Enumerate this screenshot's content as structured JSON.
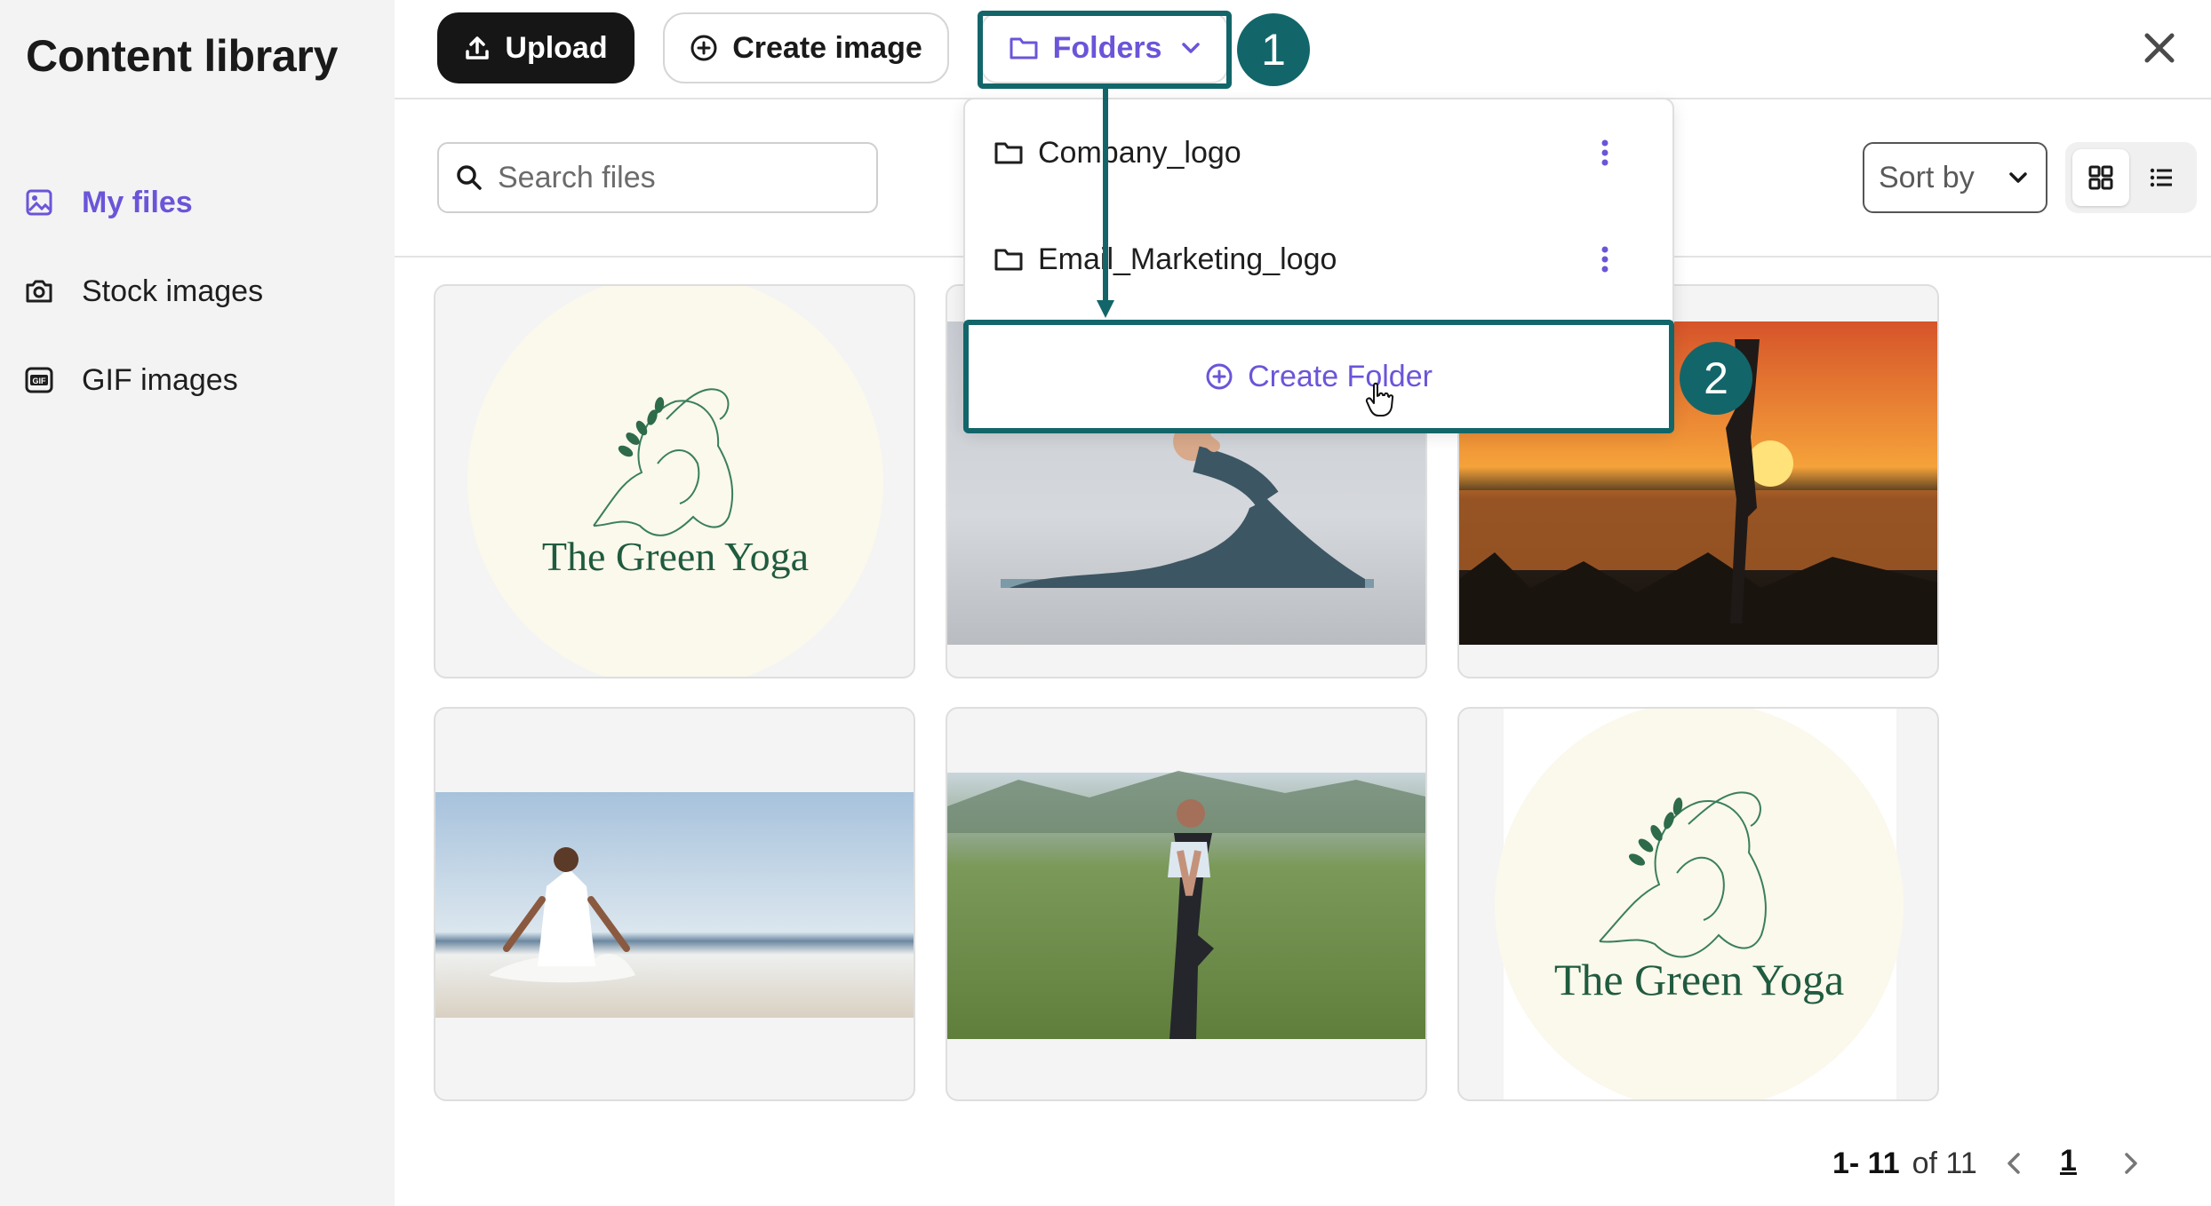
{
  "sidebar": {
    "title": "Content library",
    "items": [
      {
        "label": "My files",
        "icon": "image-icon",
        "active": true
      },
      {
        "label": "Stock images",
        "icon": "camera-icon",
        "active": false
      },
      {
        "label": "GIF images",
        "icon": "gif-icon",
        "active": false
      }
    ]
  },
  "topbar": {
    "upload_label": "Upload",
    "create_image_label": "Create image",
    "folders_label": "Folders"
  },
  "toolbar": {
    "search_placeholder": "Search files",
    "sort_label": "Sort by"
  },
  "dropdown": {
    "folders": [
      {
        "name": "Company_logo"
      },
      {
        "name": "Email_Marketing_logo"
      }
    ],
    "create_folder_label": "Create Folder"
  },
  "cards": [
    {
      "type": "logo",
      "logo_text": "The Green Yoga"
    },
    {
      "type": "photo",
      "subject": "woman side stretch on mat"
    },
    {
      "type": "photo",
      "subject": "tree pose at sunset lake"
    },
    {
      "type": "photo",
      "subject": "meditation on beach"
    },
    {
      "type": "photo",
      "subject": "tree pose in meadow"
    },
    {
      "type": "logo",
      "logo_text": "The Green Yoga"
    }
  ],
  "annotations": {
    "step1": "1",
    "step2": "2"
  },
  "pagination": {
    "range": "1- 11",
    "of_text": "of 11",
    "current_page": "1"
  },
  "colors": {
    "accent": "#6a55d9",
    "annotation": "#12666a",
    "logo_green": "#1f5b3f"
  }
}
